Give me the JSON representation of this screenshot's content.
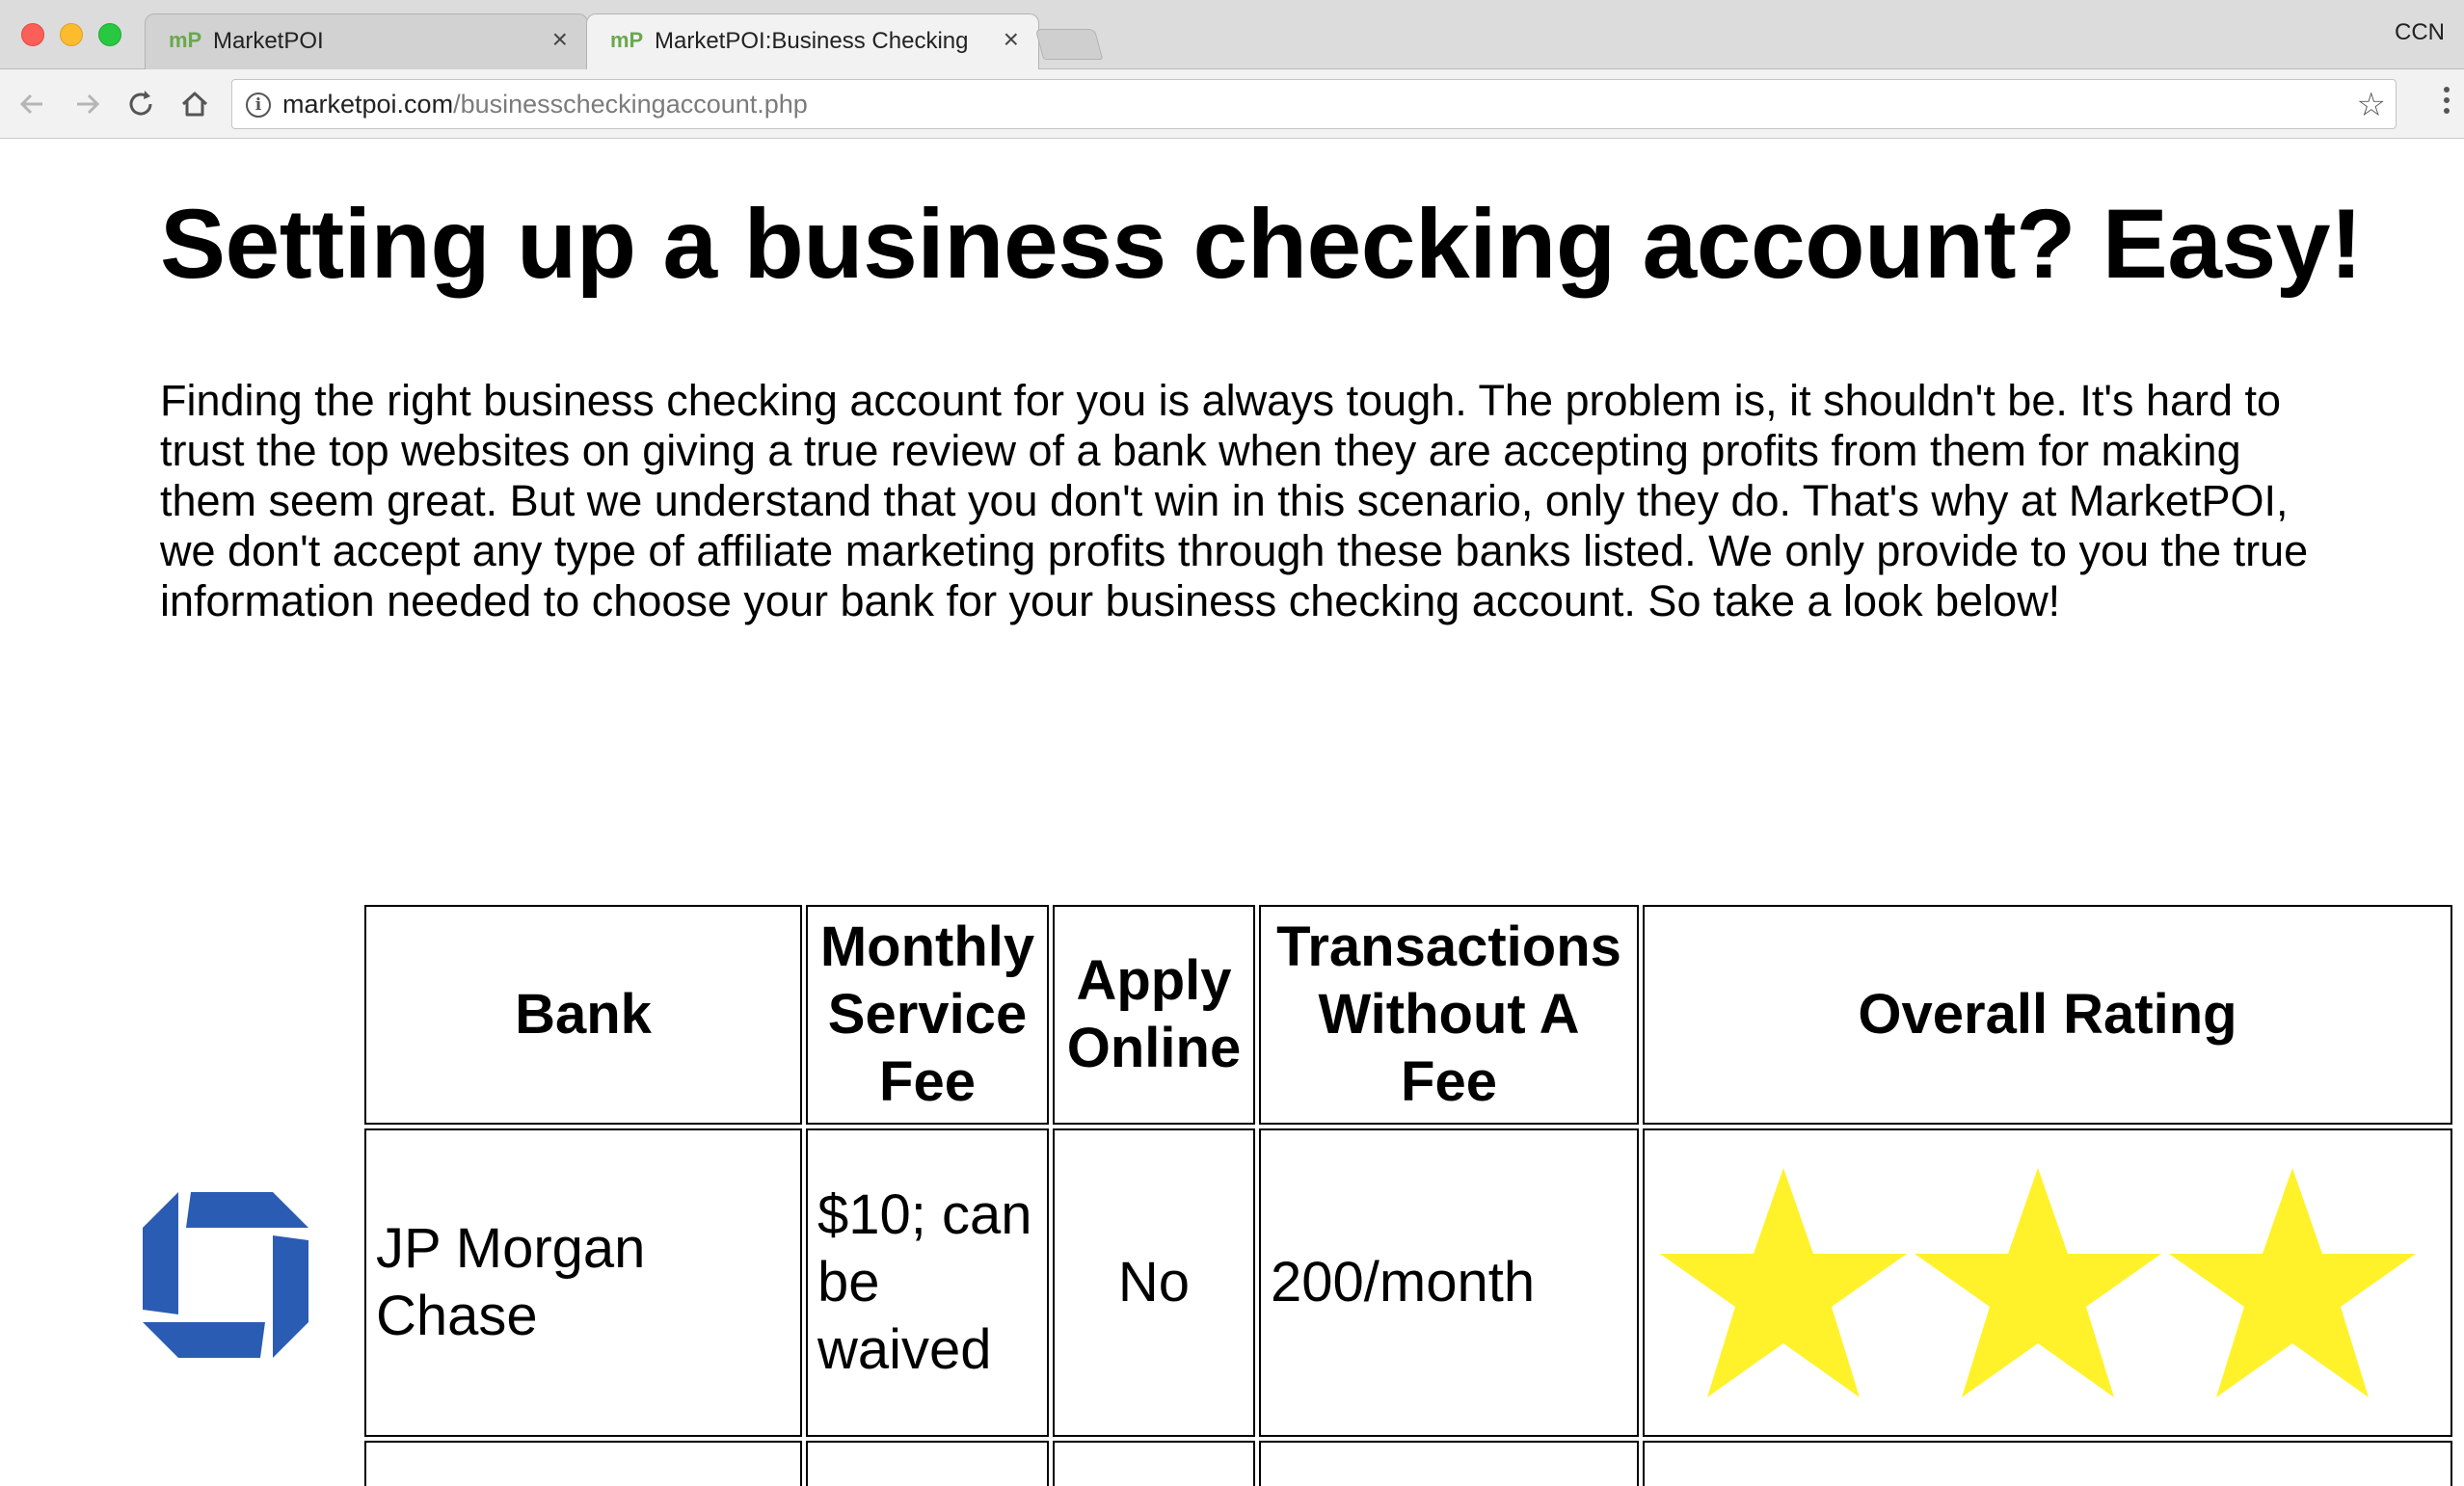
{
  "browser": {
    "tabs": [
      {
        "favicon": "mP",
        "title": "MarketPOI",
        "active": false
      },
      {
        "favicon": "mP",
        "title": "MarketPOI:Business Checking",
        "active": true
      }
    ],
    "profile_label": "CCN",
    "url_host": "marketpoi.com",
    "url_path": "/businesscheckingaccount.php"
  },
  "page": {
    "headline": "Setting up a business checking account? Easy!",
    "intro": "Finding the right business checking account for you is always tough. The problem is, it shouldn't be. It's hard to trust the top websites on giving a true review of a bank when they are accepting profits from them for making them seem great. But we understand that you don't win in this scenario, only they do. That's why at MarketPOI, we don't accept any type of affiliate marketing profits through these banks listed. We only provide to you the true information needed to choose your bank for your business checking account. So take a look below!"
  },
  "table": {
    "headers": {
      "bank": "Bank",
      "monthly_fee": "Monthly Service Fee",
      "apply_online": "Apply Online",
      "transactions": "Transactions Without A Fee",
      "rating": "Overall Rating"
    },
    "rows": [
      {
        "logo": "chase-octagon-logo",
        "bank": "JP Morgan Chase",
        "monthly_fee": "$10; can be waived",
        "apply_online": "No",
        "transactions": "200/month",
        "rating_stars": 3
      }
    ]
  },
  "colors": {
    "star": "#fff22a",
    "chase_blue": "#2b5cb3",
    "favicon_green": "#6aa84f"
  }
}
